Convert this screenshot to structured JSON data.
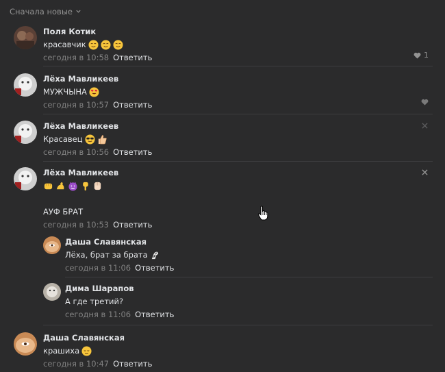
{
  "sort": {
    "label": "Сначала новые"
  },
  "comments": [
    {
      "author": "Поля Котик",
      "text": "красавчик",
      "time": "сегодня в 10:58",
      "reply": "Ответить",
      "likes": "1"
    },
    {
      "author": "Лёха Мавликеев",
      "text": "МУЖЧЫНА",
      "time": "сегодня в 10:57",
      "reply": "Ответить"
    },
    {
      "author": "Лёха Мавликеев",
      "text": "Красавец",
      "time": "сегодня в 10:56",
      "reply": "Ответить"
    },
    {
      "author": "Лёха Мавликеев",
      "text2": "АУФ БРАТ",
      "time": "сегодня в 10:53",
      "reply": "Ответить"
    },
    {
      "author": "Даша Славянская",
      "text": "Лёха, брат за брата",
      "time": "сегодня в 11:06",
      "reply": "Ответить"
    },
    {
      "author": "Дима Шарапов",
      "text": "А где третий?",
      "time": "сегодня в 11:06",
      "reply": "Ответить"
    },
    {
      "author": "Даша Славянская",
      "text": "крашиха",
      "time": "сегодня в 10:47",
      "reply": "Ответить"
    }
  ],
  "colors": {
    "background": "#2b2b2c",
    "text": "#e1e3e6",
    "muted": "#828282",
    "separator": "#3e3e40"
  },
  "icons": [
    "chevron-down-icon",
    "heart-icon",
    "close-icon",
    "hand-cursor-icon"
  ]
}
